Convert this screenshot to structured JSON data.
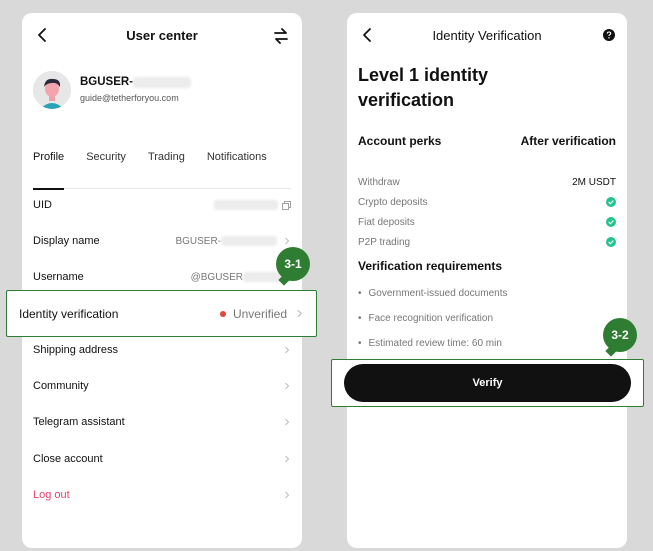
{
  "left": {
    "header": {
      "title": "User center"
    },
    "profile": {
      "username": "BGUSER-",
      "email": "guide@tetherforyou.com"
    },
    "tabs": [
      {
        "label": "Profile"
      },
      {
        "label": "Security"
      },
      {
        "label": "Trading"
      },
      {
        "label": "Notifications"
      }
    ],
    "rows": {
      "uid": {
        "label": "UID"
      },
      "display_name": {
        "label": "Display name",
        "value": "BGUSER-"
      },
      "username": {
        "label": "Username",
        "value": "@BGUSER"
      },
      "identity": {
        "label": "Identity verification",
        "status": "Unverified",
        "status_color": "#e0463c"
      },
      "shipping": {
        "label": "Shipping address"
      },
      "community": {
        "label": "Community"
      },
      "telegram": {
        "label": "Telegram assistant"
      },
      "close_account": {
        "label": "Close account"
      },
      "logout": {
        "label": "Log out",
        "color": "#e8436b"
      }
    },
    "badge": "3-1"
  },
  "right": {
    "header": {
      "title": "Identity Verification"
    },
    "title": "Level 1 identity verification",
    "perks": {
      "heading_left": "Account perks",
      "heading_right": "After verification",
      "items": [
        {
          "label": "Withdraw",
          "value": "2M USDT"
        },
        {
          "label": "Crypto deposits",
          "icon": "check-icon"
        },
        {
          "label": "Fiat deposits",
          "icon": "check-icon"
        },
        {
          "label": "P2P trading",
          "icon": "check-icon"
        }
      ]
    },
    "requirements": {
      "heading": "Verification requirements",
      "items": [
        "Government-issued documents",
        "Face recognition verification",
        "Estimated review time: 60 min"
      ]
    },
    "verify_label": "Verify",
    "badge": "3-2"
  },
  "colors": {
    "highlight": "#2e7d32",
    "check": "#22c58b",
    "button": "#111111"
  }
}
